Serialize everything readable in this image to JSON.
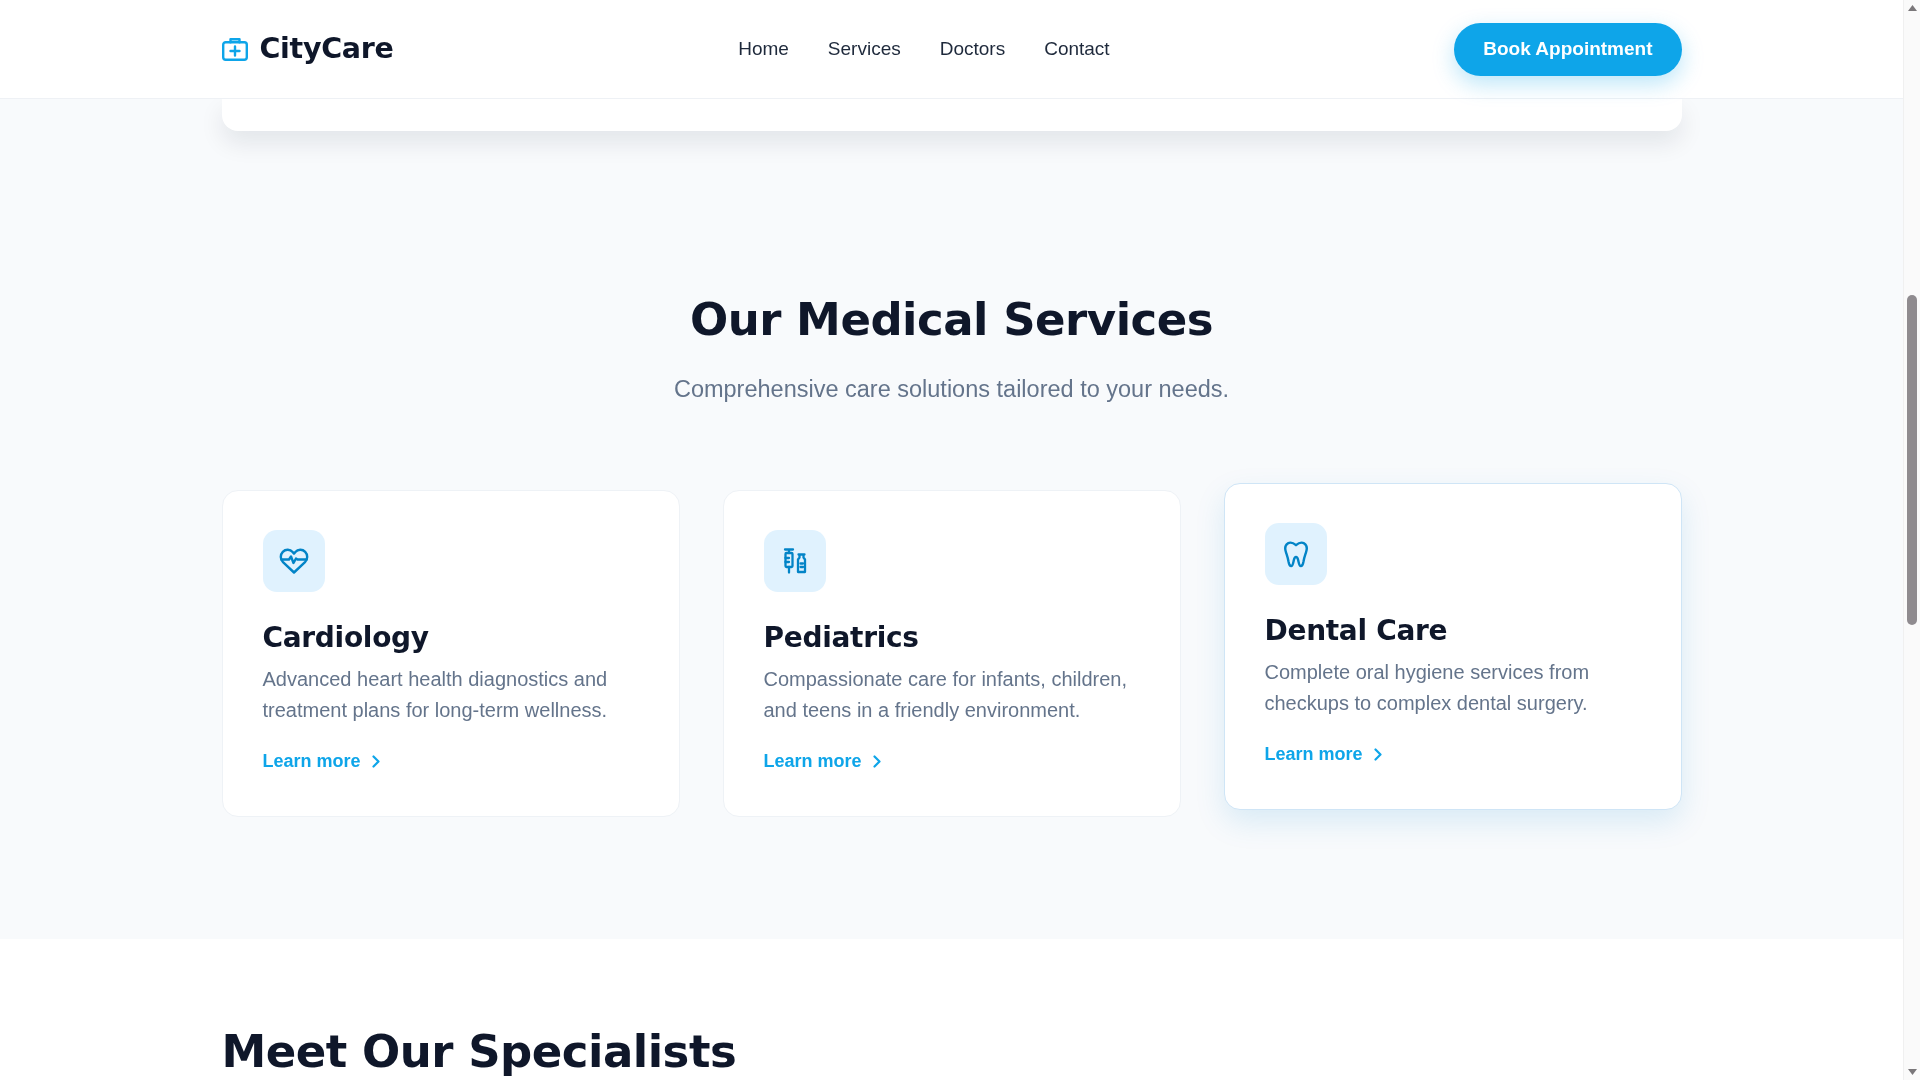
{
  "navbar": {
    "brand": "CityCare",
    "links": [
      {
        "label": "Home"
      },
      {
        "label": "Services"
      },
      {
        "label": "Doctors"
      },
      {
        "label": "Contact"
      }
    ],
    "cta": "Book Appointment"
  },
  "services": {
    "title": "Our Medical Services",
    "subtitle": "Comprehensive care solutions tailored to your needs.",
    "cards": [
      {
        "title": "Cardiology",
        "description": "Advanced heart health diagnostics and treatment plans for long-term wellness.",
        "link": "Learn more",
        "hovered": false
      },
      {
        "title": "Pediatrics",
        "description": "Compassionate care for infants, children, and teens in a friendly environment.",
        "link": "Learn more",
        "hovered": false
      },
      {
        "title": "Dental Care",
        "description": "Complete oral hygiene services from checkups to complex dental surgery.",
        "link": "Learn more",
        "hovered": true
      }
    ]
  },
  "specialists": {
    "title": "Meet Our Specialists"
  }
}
